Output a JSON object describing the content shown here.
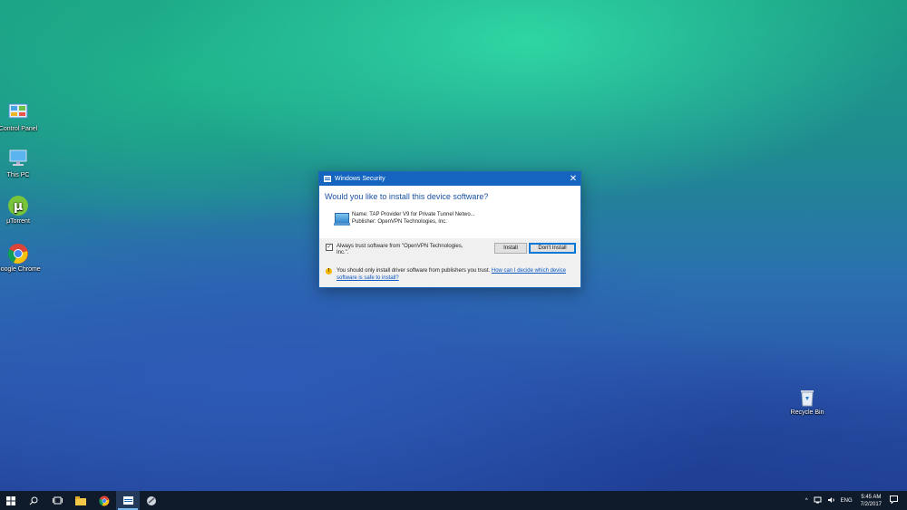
{
  "desktop": {
    "icons": [
      {
        "label": "Control Panel",
        "icon": "control-panel-icon"
      },
      {
        "label": "This PC",
        "icon": "computer-icon"
      },
      {
        "label": "μTorrent",
        "icon": "utorrent-icon"
      },
      {
        "label": "Google Chrome",
        "icon": "chrome-icon"
      },
      {
        "label": "Recycle Bin",
        "icon": "recycle-bin-icon"
      }
    ]
  },
  "dialog": {
    "title": "Windows Security",
    "close_glyph": "✕",
    "heading": "Would you like to install this device software?",
    "device_name": "Name: TAP Provider V9 for Private Tunnel Netwo...",
    "publisher": "Publisher: OpenVPN Technologies, Inc.",
    "trust_label": "Always trust software from \"OpenVPN Technologies, Inc.\".",
    "trust_checked": true,
    "install_label": "Install",
    "dont_install_label": "Don't Install",
    "warning_text": "You should only install driver software from publishers you trust.",
    "warning_link": "How can I decide which device software is safe to install?"
  },
  "taskbar": {
    "tray_chevron": "^",
    "language": "ENG",
    "time": "5:45 AM",
    "date": "7/2/2017"
  },
  "colors": {
    "accent": "#1565c0",
    "link": "#0a56c2",
    "taskbar": "#0f1b2a"
  }
}
